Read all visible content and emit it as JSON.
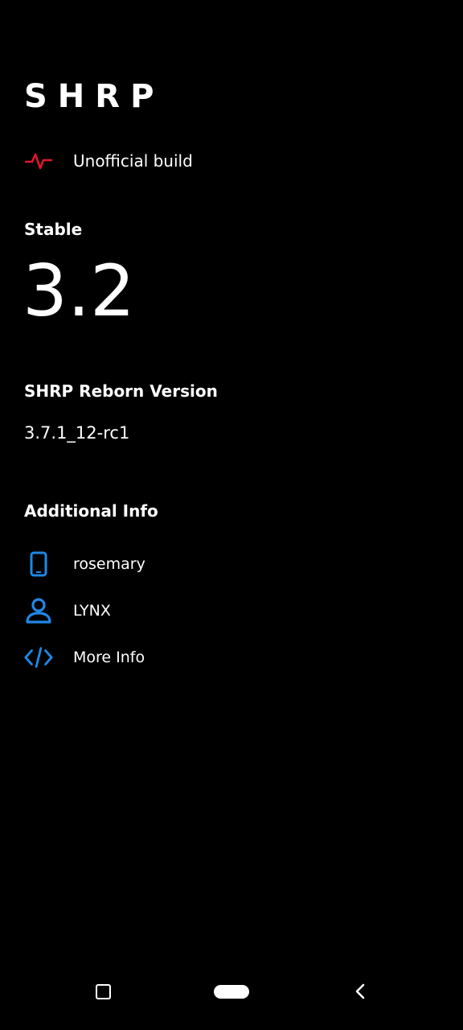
{
  "app": {
    "title": "SHRP"
  },
  "build": {
    "label": "Unofficial build",
    "icon": "pulse-icon",
    "icon_color": "#e5142a"
  },
  "version": {
    "channel_label": "Stable",
    "number": "3.2"
  },
  "reborn": {
    "heading": "SHRP Reborn Version",
    "value": "3.7.1_12-rc1"
  },
  "additional_info": {
    "heading": "Additional Info",
    "accent_color": "#1e88e5",
    "items": [
      {
        "icon": "phone-icon",
        "label": "rosemary"
      },
      {
        "icon": "person-icon",
        "label": "LYNX"
      },
      {
        "icon": "code-icon",
        "label": "More Info"
      }
    ]
  },
  "navigation": {
    "buttons": [
      "recents-button",
      "home-button",
      "back-button"
    ]
  },
  "colors": {
    "background": "#000000",
    "text": "#ffffff"
  }
}
